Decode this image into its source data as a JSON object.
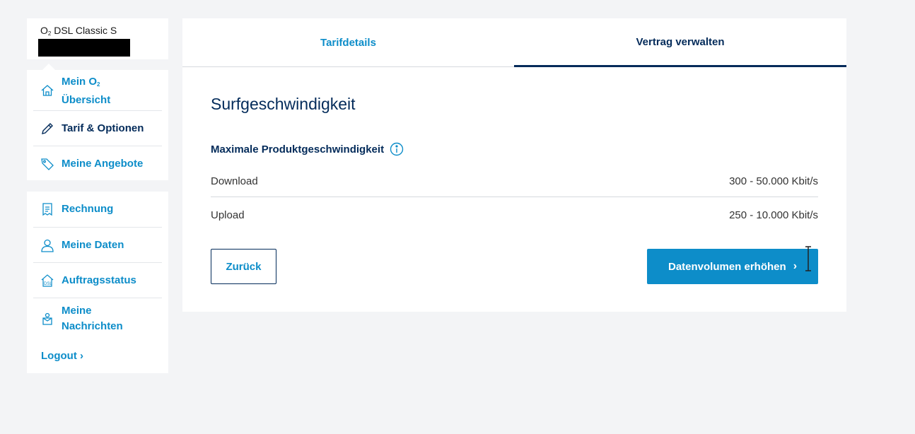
{
  "sidebar": {
    "tariff": {
      "name_prefix": "O",
      "name_sub": "2",
      "name_rest": " DSL Classic S"
    },
    "group1": [
      {
        "label_line1": "Mein O",
        "label_sub": "2",
        "label_line2": "Übersicht",
        "icon": "home-icon"
      },
      {
        "label": "Tarif & Optionen",
        "icon": "pencil-icon",
        "active": true
      },
      {
        "label": "Meine Angebote",
        "icon": "tag-icon"
      }
    ],
    "group2": [
      {
        "label": "Rechnung",
        "icon": "invoice-icon"
      },
      {
        "label": "Meine Daten",
        "icon": "user-icon"
      },
      {
        "label": "Auftragsstatus",
        "icon": "dsl-house-icon"
      },
      {
        "label_line1": "Meine",
        "label_line2": "Nachrichten",
        "icon": "messages-icon"
      }
    ],
    "logout": "Logout"
  },
  "tabs": [
    {
      "label": "Tarifdetails"
    },
    {
      "label": "Vertrag verwalten",
      "active": true
    }
  ],
  "main": {
    "title": "Surfgeschwindigkeit",
    "subheading": "Maximale Produktgeschwindigkeit",
    "rows": [
      {
        "label": "Download",
        "value": "300 - 50.000 Kbit/s"
      },
      {
        "label": "Upload",
        "value": "250 - 10.000 Kbit/s"
      }
    ],
    "back_button": "Zurück",
    "primary_button": "Datenvolumen erhöhen"
  },
  "colors": {
    "accent": "#0d8dc9",
    "navy": "#032b5a",
    "background": "#f3f4f6"
  }
}
